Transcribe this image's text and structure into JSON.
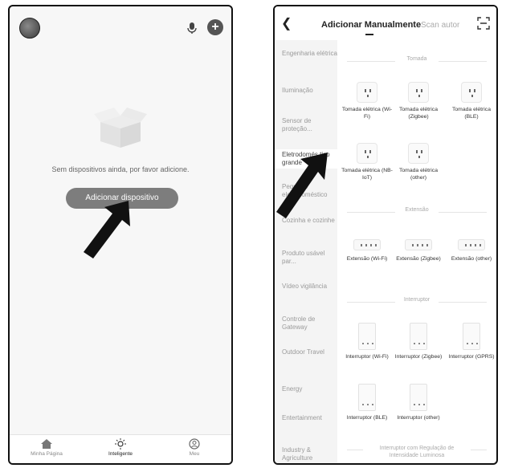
{
  "left_screen": {
    "empty_message": "Sem dispositivos ainda, por favor adicione.",
    "add_device_button": "Adicionar dispositivo",
    "tabs": [
      "Minha Página",
      "Inteligente",
      "Meu"
    ]
  },
  "right_screen": {
    "tab_manual": "Adicionar Manualmente",
    "tab_scan": "Scan autor",
    "sidebar": [
      "Engenharia elétrica",
      "Iluminação",
      "Sensor de proteção...",
      "Eletrodomés tico grande",
      "Pequeno eletrodoméstico",
      "Cozinha e cozinhe",
      "Produto usável par...",
      "Vídeo vigilância",
      "Controle de Gateway",
      "Outdoor Travel",
      "Energy",
      "Entertainment",
      "Industry & Agriculture"
    ],
    "sections": {
      "tomada": "Tomada",
      "extensao": "Extensão",
      "interruptor": "Interruptor",
      "regulacao": "Interruptor com Regulação de Intensidade Luminosa"
    },
    "tomada_devices": [
      "Tomada elétrica (Wi-Fi)",
      "Tomada elétrica (Zigbee)",
      "Tomada elétrica (BLE)",
      "Tomada elétrica (NB-IoT)",
      "Tomada elétrica (other)"
    ],
    "extensao_devices": [
      "Extensão (Wi-Fi)",
      "Extensão (Zigbee)",
      "Extensão (other)"
    ],
    "interruptor_devices": [
      "Interruptor (Wi-Fi)",
      "Interruptor (Zigbee)",
      "Interruptor (GPRS)",
      "Interruptor (BLE)",
      "Interruptor (other)"
    ]
  }
}
